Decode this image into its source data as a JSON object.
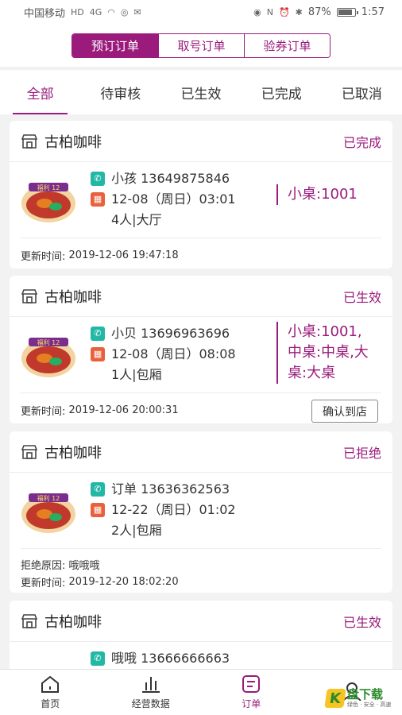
{
  "status_bar": {
    "carrier": "中国移动",
    "net1": "HD",
    "net2": "4G",
    "battery": "87%",
    "time": "1:57"
  },
  "segments": [
    "预订订单",
    "取号订单",
    "验券订单"
  ],
  "tabs": [
    "全部",
    "待审核",
    "已生效",
    "已完成",
    "已取消"
  ],
  "orders": [
    {
      "shop": "古柏咖啡",
      "status": "已完成",
      "contact": "小孩 13649875846",
      "date": "12-08（周日）03:01",
      "people": "4人|大厅",
      "table_lines": [
        "小桌:1001"
      ],
      "update_label": "更新时间:",
      "update_time": "2019-12-06 19:47:18"
    },
    {
      "shop": "古柏咖啡",
      "status": "已生效",
      "contact": "小贝 13696963696",
      "date": "12-08（周日）08:08",
      "people": "1人|包厢",
      "table_lines": [
        "小桌:1001,",
        "中桌:中桌,大",
        "桌:大桌"
      ],
      "update_label": "更新时间:",
      "update_time": "2019-12-06 20:00:31",
      "action": "确认到店"
    },
    {
      "shop": "古柏咖啡",
      "status": "已拒绝",
      "contact": "订单 13636362563",
      "date": "12-22（周日）01:02",
      "people": "2人|包厢",
      "table_lines": [],
      "reject_label": "拒绝原因:",
      "reject_reason": "哦哦哦",
      "update_label": "更新时间:",
      "update_time": "2019-12-20 18:02:20"
    },
    {
      "shop": "古柏咖啡",
      "status": "已生效",
      "contact": "哦哦 13666666663"
    }
  ],
  "bottom_nav": [
    "首页",
    "经营数据",
    "订单",
    ""
  ],
  "watermark": {
    "logo": "K",
    "title": "盘下载",
    "sub": "绿色 · 安全 · 高速"
  },
  "colors": {
    "accent": "#9a1b7b",
    "phone_icon": "#23b8a6",
    "calendar_icon": "#e8613c"
  }
}
